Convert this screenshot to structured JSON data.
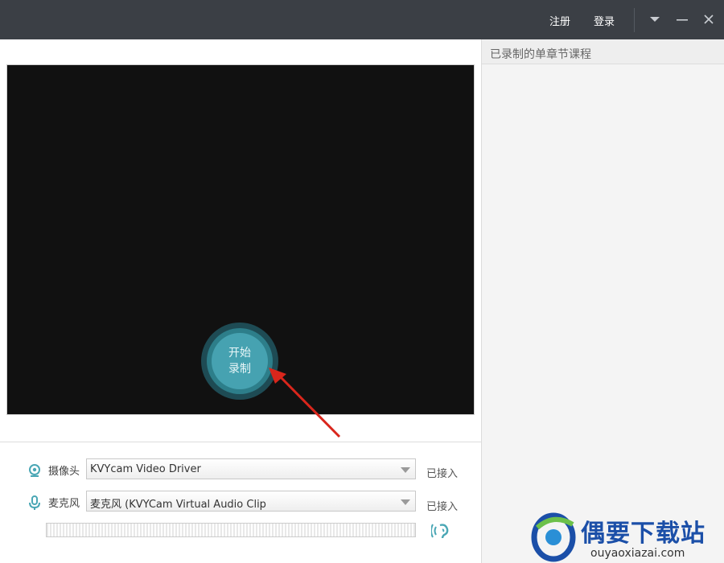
{
  "titlebar": {
    "register_label": "注册",
    "login_label": "登录",
    "bg_color": "#3b3f45"
  },
  "preview": {
    "record_button_line1": "开始",
    "record_button_line2": "录制",
    "accent_color": "#46a2b1",
    "annotation_arrow_color": "#d9261c"
  },
  "devices": {
    "camera": {
      "label": "摄像头",
      "icon": "webcam-icon",
      "selected": "KVYcam Video Driver",
      "status": "已接入"
    },
    "microphone": {
      "label": "麦克风",
      "icon": "microphone-icon",
      "selected": "麦克风 (KVYCam Virtual Audio Clip",
      "status": "已接入"
    },
    "level_meter_icon": "ear-icon"
  },
  "sidebar": {
    "title": "已录制的单章节课程"
  },
  "watermark": {
    "cn": "偶要下载站",
    "en": "ouyaoxiazai.com"
  }
}
